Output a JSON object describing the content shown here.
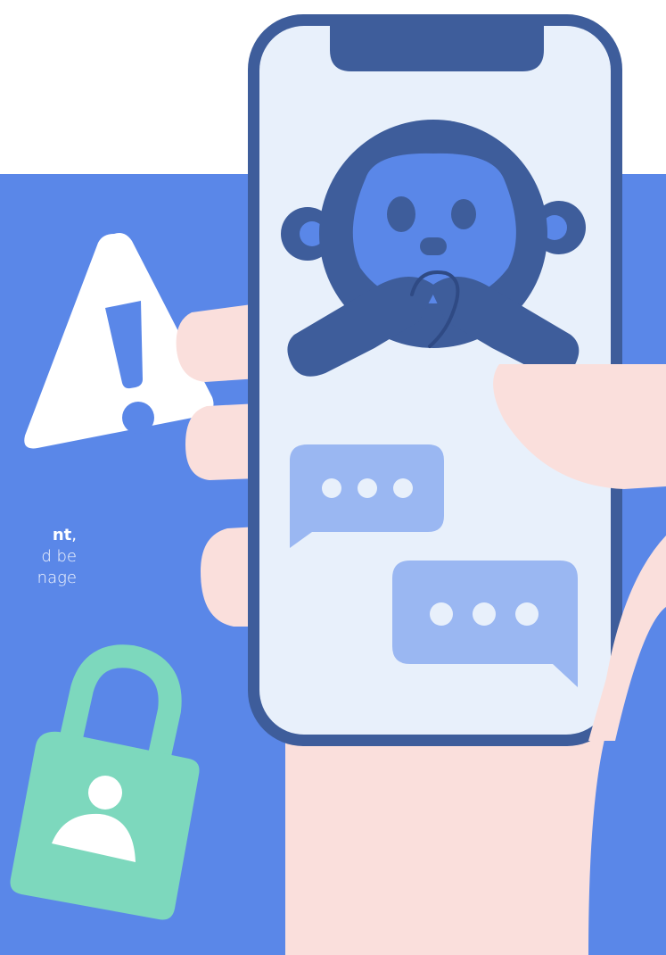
{
  "caption": {
    "line1_strong": "nt",
    "line1_tail": ",",
    "line2": "d be",
    "line3": "nage"
  },
  "colors": {
    "background": "#ffffff",
    "panel_blue": "#5a87e8",
    "phone_frame": "#3e5d9b",
    "phone_screen": "#e8f0fb",
    "monkey_dark": "#3e5d9b",
    "monkey_face": "#5a87e8",
    "bubble": "#9ab7f2",
    "skin": "#fadfdc",
    "warning_white": "#ffffff",
    "lock_green": "#7dd8bd"
  },
  "icons": {
    "warning": "warning-triangle-icon",
    "lock": "padlock-user-icon",
    "monkey": "speak-no-evil-monkey-icon",
    "chat_left": "chat-bubble-ellipsis-icon",
    "chat_right": "chat-bubble-ellipsis-icon"
  }
}
